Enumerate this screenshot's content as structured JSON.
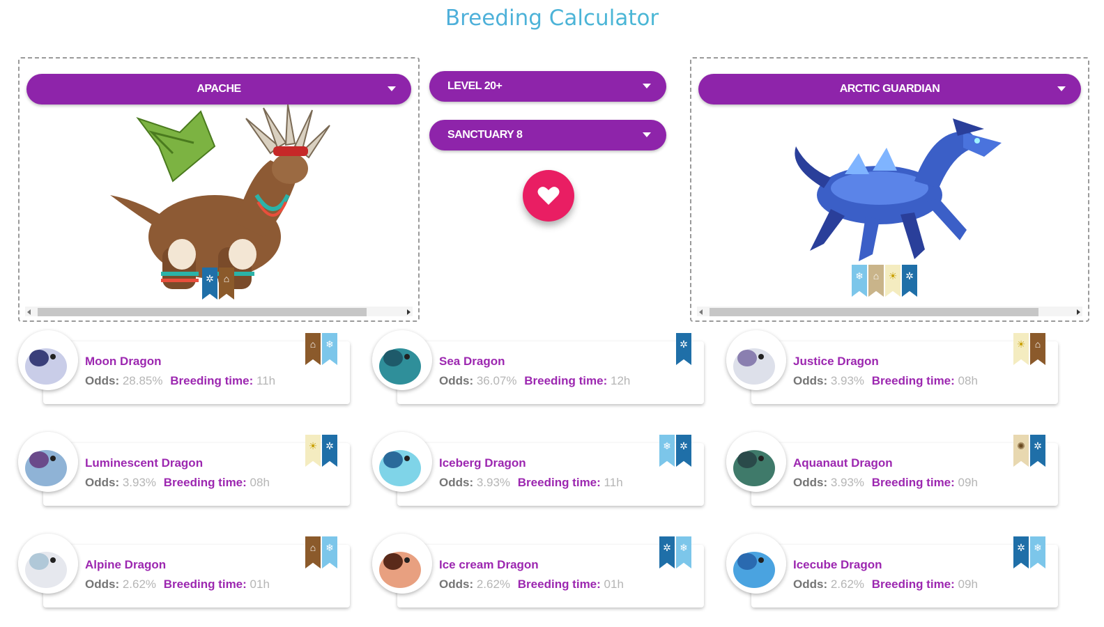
{
  "title": "Breeding Calculator",
  "parent_left": {
    "selected": "APACHE",
    "badges": [
      "snow",
      "earth"
    ]
  },
  "parent_right": {
    "selected": "ARCTIC GUARDIAN",
    "badges": [
      "ice",
      "earth",
      "light",
      "snow"
    ]
  },
  "level_select": {
    "selected": "LEVEL 20+"
  },
  "sanctuary_select": {
    "selected": "SANCTUARY 8"
  },
  "breed_button_icon": "heart-icon",
  "labels": {
    "odds": "Odds:",
    "breeding_time": "Breeding time:"
  },
  "results": [
    {
      "name": "Moon Dragon",
      "odds": "28.85%",
      "time": "11h",
      "badges": [
        "earth",
        "ice"
      ]
    },
    {
      "name": "Sea Dragon",
      "odds": "36.07%",
      "time": "12h",
      "badges": [
        "snow"
      ]
    },
    {
      "name": "Justice Dragon",
      "odds": "3.93%",
      "time": "08h",
      "badges": [
        "light",
        "earth"
      ]
    },
    {
      "name": "Luminescent Dragon",
      "odds": "3.93%",
      "time": "08h",
      "badges": [
        "light",
        "snow"
      ]
    },
    {
      "name": "Iceberg Dragon",
      "odds": "3.93%",
      "time": "11h",
      "badges": [
        "ice",
        "snow"
      ]
    },
    {
      "name": "Aquanaut Dragon",
      "odds": "3.93%",
      "time": "09h",
      "badges": [
        "primal",
        "snow"
      ]
    },
    {
      "name": "Alpine Dragon",
      "odds": "2.62%",
      "time": "01h",
      "badges": [
        "earth",
        "ice"
      ]
    },
    {
      "name": "Ice cream Dragon",
      "odds": "2.62%",
      "time": "01h",
      "badges": [
        "snow",
        "ice"
      ]
    },
    {
      "name": "Icecube Dragon",
      "odds": "2.62%",
      "time": "09h",
      "badges": [
        "snow",
        "ice"
      ]
    }
  ],
  "colors": {
    "accent": "#8e24aa",
    "heart": "#e91e63",
    "name": "#9c27b0"
  }
}
